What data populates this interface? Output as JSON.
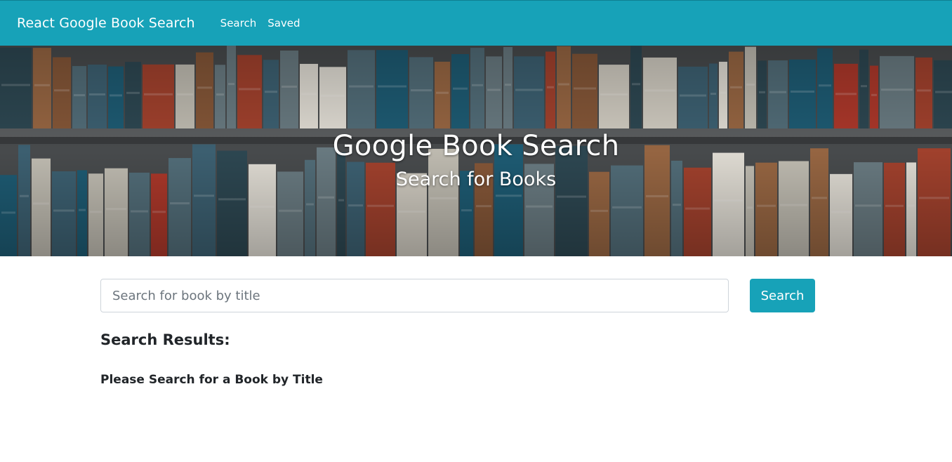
{
  "navbar": {
    "brand": "React Google Book Search",
    "links": [
      "Search",
      "Saved"
    ]
  },
  "hero": {
    "title": "Google Book Search",
    "subtitle": "Search for Books"
  },
  "search": {
    "placeholder": "Search for book by title",
    "value": "",
    "button_label": "Search"
  },
  "results": {
    "heading": "Search Results:",
    "empty_message": "Please Search for a Book by Title"
  },
  "colors": {
    "accent": "#17a2b8",
    "text": "#212529"
  }
}
